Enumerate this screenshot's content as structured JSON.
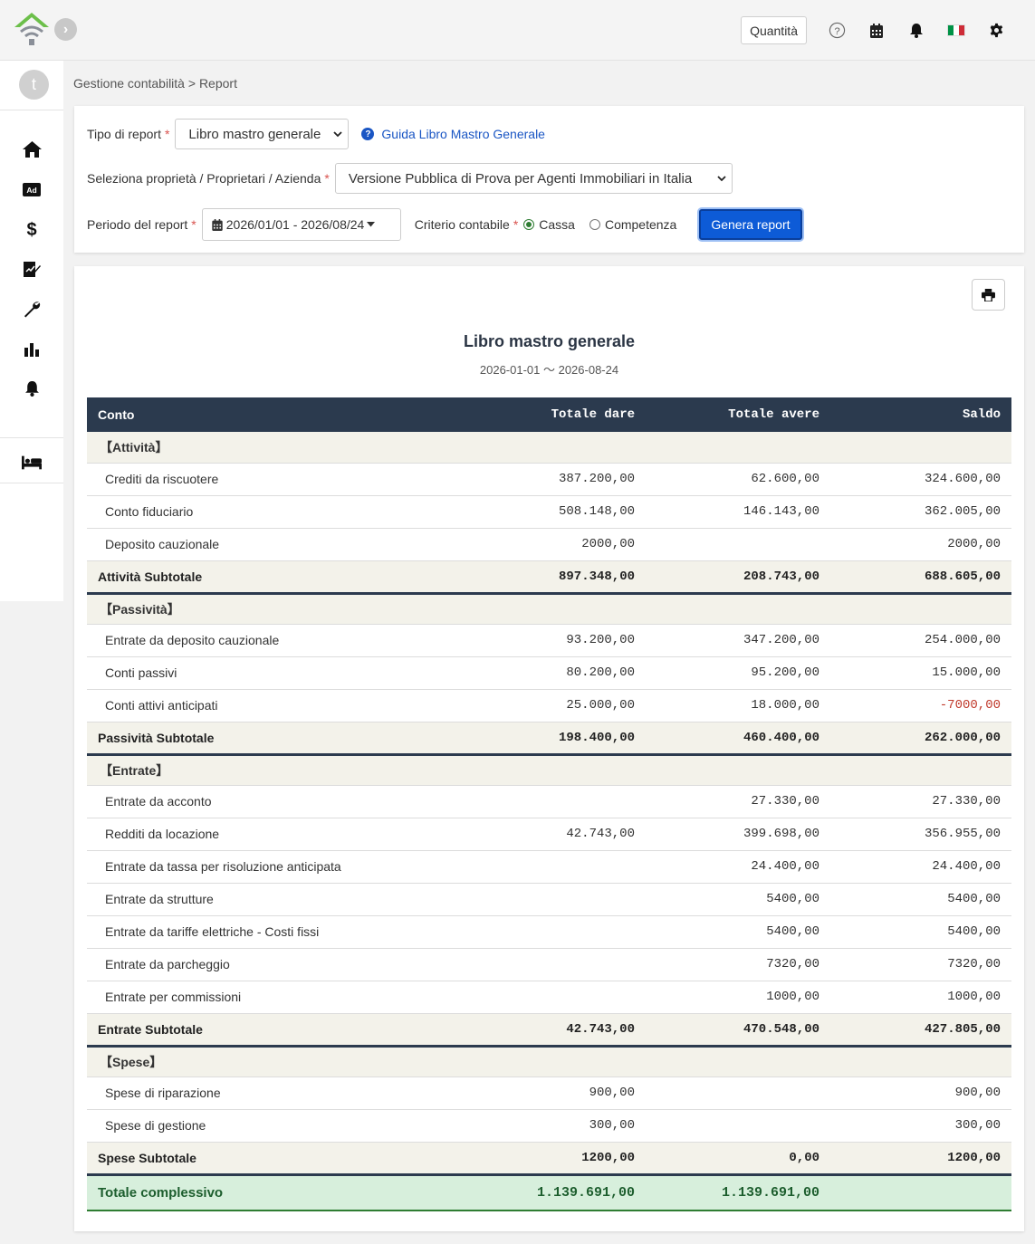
{
  "topbar": {
    "quantity_label": "Quantità",
    "icons": [
      "help-icon",
      "calendar-icon",
      "bell-icon",
      "italy-flag-icon",
      "gear-icon"
    ]
  },
  "sidebar": {
    "avatar_initial": "t",
    "items": [
      "home-icon",
      "ad-icon",
      "dollar-icon",
      "contract-icon",
      "wrench-icon",
      "bar-chart-icon",
      "bell-icon",
      "bed-icon"
    ]
  },
  "breadcrumb": {
    "parent": "Gestione contabilità",
    "separator": ">",
    "current": "Report"
  },
  "filters": {
    "report_type_label": "Tipo di report",
    "report_type_value": "Libro mastro generale",
    "guide_link": "Guida Libro Mastro Generale",
    "property_label": "Seleziona proprietà / Proprietari / Azienda",
    "property_value": "Versione Pubblica di Prova per Agenti Immobiliari in Italia",
    "period_label": "Periodo del report",
    "period_value": "2026/01/01 - 2026/08/24",
    "criterion_label": "Criterio contabile",
    "option_cash": "Cassa",
    "option_accrual": "Competenza",
    "selected_option": "Cassa",
    "generate_button": "Genera report",
    "required_mark": "*"
  },
  "report": {
    "title": "Libro mastro generale",
    "subtitle": "2026-01-01 〜 2026-08-24",
    "columns": {
      "account": "Conto",
      "debit": "Totale dare",
      "credit": "Totale avere",
      "balance": "Saldo"
    },
    "sections": [
      {
        "name": "【Attività】",
        "rows": [
          {
            "account": "Crediti da riscuotere",
            "debit": "387.200,00",
            "credit": "62.600,00",
            "balance": "324.600,00"
          },
          {
            "account": "Conto fiduciario",
            "debit": "508.148,00",
            "credit": "146.143,00",
            "balance": "362.005,00"
          },
          {
            "account": "Deposito cauzionale",
            "debit": "2000,00",
            "credit": "",
            "balance": "2000,00"
          }
        ],
        "subtotal": {
          "account": "Attività Subtotale",
          "debit": "897.348,00",
          "credit": "208.743,00",
          "balance": "688.605,00"
        }
      },
      {
        "name": "【Passività】",
        "rows": [
          {
            "account": "Entrate da deposito cauzionale",
            "debit": "93.200,00",
            "credit": "347.200,00",
            "balance": "254.000,00"
          },
          {
            "account": "Conti passivi",
            "debit": "80.200,00",
            "credit": "95.200,00",
            "balance": "15.000,00"
          },
          {
            "account": "Conti attivi anticipati",
            "debit": "25.000,00",
            "credit": "18.000,00",
            "balance": "-7000,00"
          }
        ],
        "subtotal": {
          "account": "Passività Subtotale",
          "debit": "198.400,00",
          "credit": "460.400,00",
          "balance": "262.000,00"
        }
      },
      {
        "name": "【Entrate】",
        "rows": [
          {
            "account": "Entrate da acconto",
            "debit": "",
            "credit": "27.330,00",
            "balance": "27.330,00"
          },
          {
            "account": "Redditi da locazione",
            "debit": "42.743,00",
            "credit": "399.698,00",
            "balance": "356.955,00"
          },
          {
            "account": "Entrate da tassa per risoluzione anticipata",
            "debit": "",
            "credit": "24.400,00",
            "balance": "24.400,00"
          },
          {
            "account": "Entrate da strutture",
            "debit": "",
            "credit": "5400,00",
            "balance": "5400,00"
          },
          {
            "account": "Entrate da tariffe elettriche - Costi fissi",
            "debit": "",
            "credit": "5400,00",
            "balance": "5400,00"
          },
          {
            "account": "Entrate da parcheggio",
            "debit": "",
            "credit": "7320,00",
            "balance": "7320,00"
          },
          {
            "account": "Entrate per commissioni",
            "debit": "",
            "credit": "1000,00",
            "balance": "1000,00"
          }
        ],
        "subtotal": {
          "account": "Entrate Subtotale",
          "debit": "42.743,00",
          "credit": "470.548,00",
          "balance": "427.805,00"
        }
      },
      {
        "name": "【Spese】",
        "rows": [
          {
            "account": "Spese di riparazione",
            "debit": "900,00",
            "credit": "",
            "balance": "900,00"
          },
          {
            "account": "Spese di gestione",
            "debit": "300,00",
            "credit": "",
            "balance": "300,00"
          }
        ],
        "subtotal": {
          "account": "Spese Subtotale",
          "debit": "1200,00",
          "credit": "0,00",
          "balance": "1200,00"
        }
      }
    ],
    "grand_total": {
      "account": "Totale complessivo",
      "debit": "1.139.691,00",
      "credit": "1.139.691,00",
      "balance": ""
    }
  },
  "colors": {
    "header_bg": "#2b3a4e",
    "section_bg": "#f3f2ea",
    "grand_bg": "#d7efdc",
    "primary_button": "#0d5bd7",
    "link": "#1a56c4",
    "negative": "#c0392b",
    "logo_green": "#6cbf4a"
  }
}
